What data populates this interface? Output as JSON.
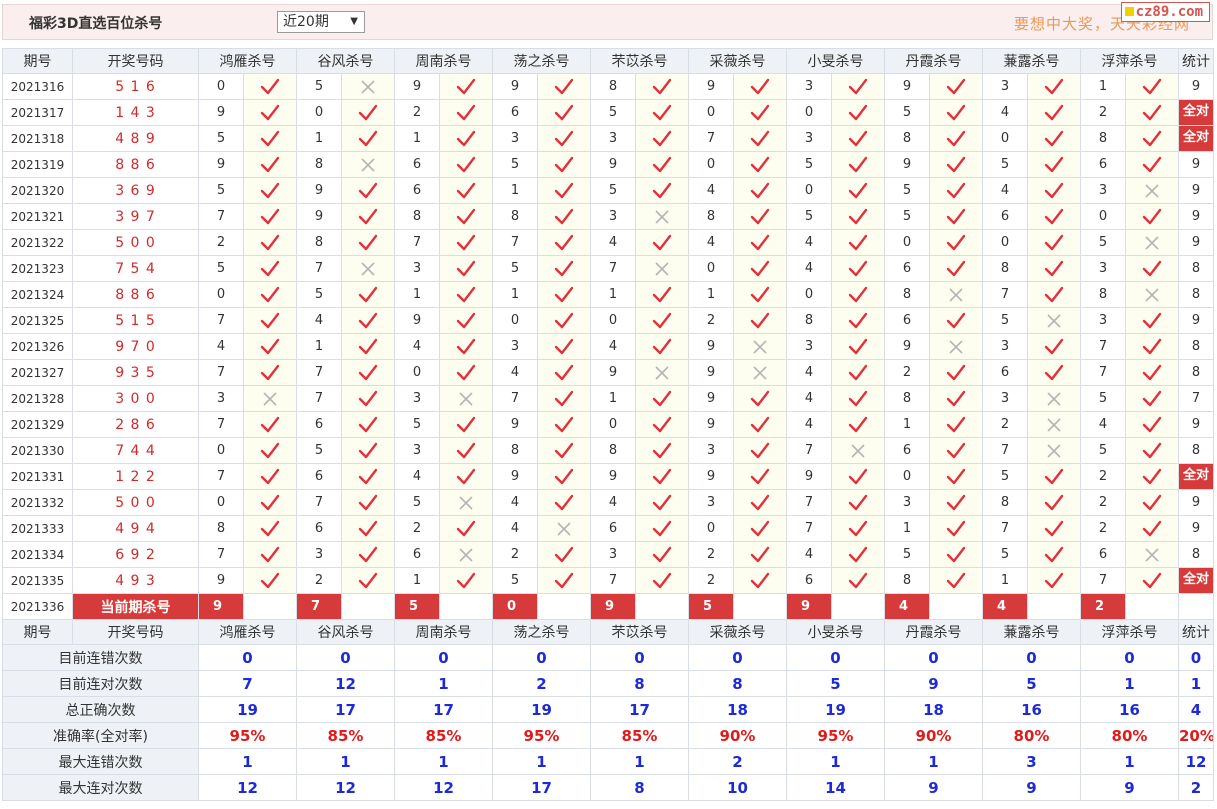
{
  "header": {
    "title": "福彩3D直选百位杀号",
    "period_select": "近20期",
    "slogan": "要想中大奖，天天彩经网",
    "logo": "cz89.com"
  },
  "columns": {
    "period": "期号",
    "draw": "开奖号码",
    "experts": [
      "鸿雁杀号",
      "谷风杀号",
      "周南杀号",
      "荡之杀号",
      "芣苡杀号",
      "采薇杀号",
      "小旻杀号",
      "丹霞杀号",
      "蒹露杀号",
      "浮萍杀号"
    ],
    "stat": "统计"
  },
  "all_right_label": "全对",
  "rows": [
    {
      "period": "2021316",
      "draw": "5 1 6",
      "kills": [
        0,
        5,
        9,
        9,
        8,
        9,
        3,
        9,
        3,
        1
      ],
      "ok": [
        1,
        0,
        1,
        1,
        1,
        1,
        1,
        1,
        1,
        1
      ],
      "stat": "9"
    },
    {
      "period": "2021317",
      "draw": "1 4 3",
      "kills": [
        9,
        0,
        2,
        6,
        5,
        0,
        0,
        5,
        4,
        2
      ],
      "ok": [
        1,
        1,
        1,
        1,
        1,
        1,
        1,
        1,
        1,
        1
      ],
      "stat": "全对"
    },
    {
      "period": "2021318",
      "draw": "4 8 9",
      "kills": [
        5,
        1,
        1,
        3,
        3,
        7,
        3,
        8,
        0,
        8
      ],
      "ok": [
        1,
        1,
        1,
        1,
        1,
        1,
        1,
        1,
        1,
        1
      ],
      "stat": "全对"
    },
    {
      "period": "2021319",
      "draw": "8 8 6",
      "kills": [
        9,
        8,
        6,
        5,
        9,
        0,
        5,
        9,
        5,
        6
      ],
      "ok": [
        1,
        0,
        1,
        1,
        1,
        1,
        1,
        1,
        1,
        1
      ],
      "stat": "9"
    },
    {
      "period": "2021320",
      "draw": "3 6 9",
      "kills": [
        5,
        9,
        6,
        1,
        5,
        4,
        0,
        5,
        4,
        3
      ],
      "ok": [
        1,
        1,
        1,
        1,
        1,
        1,
        1,
        1,
        1,
        0
      ],
      "stat": "9"
    },
    {
      "period": "2021321",
      "draw": "3 9 7",
      "kills": [
        7,
        9,
        8,
        8,
        3,
        8,
        5,
        5,
        6,
        0
      ],
      "ok": [
        1,
        1,
        1,
        1,
        0,
        1,
        1,
        1,
        1,
        1
      ],
      "stat": "9"
    },
    {
      "period": "2021322",
      "draw": "5 0 0",
      "kills": [
        2,
        8,
        7,
        7,
        4,
        4,
        4,
        0,
        0,
        5
      ],
      "ok": [
        1,
        1,
        1,
        1,
        1,
        1,
        1,
        1,
        1,
        0
      ],
      "stat": "9"
    },
    {
      "period": "2021323",
      "draw": "7 5 4",
      "kills": [
        5,
        7,
        3,
        5,
        7,
        0,
        4,
        6,
        8,
        3
      ],
      "ok": [
        1,
        0,
        1,
        1,
        0,
        1,
        1,
        1,
        1,
        1
      ],
      "stat": "8"
    },
    {
      "period": "2021324",
      "draw": "8 8 6",
      "kills": [
        0,
        5,
        1,
        1,
        1,
        1,
        0,
        8,
        7,
        8
      ],
      "ok": [
        1,
        1,
        1,
        1,
        1,
        1,
        1,
        0,
        1,
        0
      ],
      "stat": "8"
    },
    {
      "period": "2021325",
      "draw": "5 1 5",
      "kills": [
        7,
        4,
        9,
        0,
        0,
        2,
        8,
        6,
        5,
        3
      ],
      "ok": [
        1,
        1,
        1,
        1,
        1,
        1,
        1,
        1,
        0,
        1
      ],
      "stat": "9"
    },
    {
      "period": "2021326",
      "draw": "9 7 0",
      "kills": [
        4,
        1,
        4,
        3,
        4,
        9,
        3,
        9,
        3,
        7
      ],
      "ok": [
        1,
        1,
        1,
        1,
        1,
        0,
        1,
        0,
        1,
        1
      ],
      "stat": "8"
    },
    {
      "period": "2021327",
      "draw": "9 3 5",
      "kills": [
        7,
        7,
        0,
        4,
        9,
        9,
        4,
        2,
        6,
        7
      ],
      "ok": [
        1,
        1,
        1,
        1,
        0,
        0,
        1,
        1,
        1,
        1
      ],
      "stat": "8"
    },
    {
      "period": "2021328",
      "draw": "3 0 0",
      "kills": [
        3,
        7,
        3,
        7,
        1,
        9,
        4,
        8,
        3,
        5
      ],
      "ok": [
        0,
        1,
        0,
        1,
        1,
        1,
        1,
        1,
        0,
        1
      ],
      "stat": "7"
    },
    {
      "period": "2021329",
      "draw": "2 8 6",
      "kills": [
        7,
        6,
        5,
        9,
        0,
        9,
        4,
        1,
        2,
        4
      ],
      "ok": [
        1,
        1,
        1,
        1,
        1,
        1,
        1,
        1,
        0,
        1
      ],
      "stat": "9"
    },
    {
      "period": "2021330",
      "draw": "7 4 4",
      "kills": [
        0,
        5,
        3,
        8,
        8,
        3,
        7,
        6,
        7,
        5
      ],
      "ok": [
        1,
        1,
        1,
        1,
        1,
        1,
        0,
        1,
        0,
        1
      ],
      "stat": "8"
    },
    {
      "period": "2021331",
      "draw": "1 2 2",
      "kills": [
        7,
        6,
        4,
        9,
        9,
        9,
        9,
        0,
        5,
        2
      ],
      "ok": [
        1,
        1,
        1,
        1,
        1,
        1,
        1,
        1,
        1,
        1
      ],
      "stat": "全对"
    },
    {
      "period": "2021332",
      "draw": "5 0 0",
      "kills": [
        0,
        7,
        5,
        4,
        4,
        3,
        7,
        3,
        8,
        2
      ],
      "ok": [
        1,
        1,
        0,
        1,
        1,
        1,
        1,
        1,
        1,
        1
      ],
      "stat": "9"
    },
    {
      "period": "2021333",
      "draw": "4 9 4",
      "kills": [
        8,
        6,
        2,
        4,
        6,
        0,
        7,
        1,
        7,
        2
      ],
      "ok": [
        1,
        1,
        1,
        0,
        1,
        1,
        1,
        1,
        1,
        1
      ],
      "stat": "9"
    },
    {
      "period": "2021334",
      "draw": "6 9 2",
      "kills": [
        7,
        3,
        6,
        2,
        3,
        2,
        4,
        5,
        5,
        6
      ],
      "ok": [
        1,
        1,
        0,
        1,
        1,
        1,
        1,
        1,
        1,
        0
      ],
      "stat": "8"
    },
    {
      "period": "2021335",
      "draw": "4 9 3",
      "kills": [
        9,
        2,
        1,
        5,
        7,
        2,
        6,
        8,
        1,
        7
      ],
      "ok": [
        1,
        1,
        1,
        1,
        1,
        1,
        1,
        1,
        1,
        1
      ],
      "stat": "全对"
    }
  ],
  "current": {
    "period": "2021336",
    "label": "当前期杀号",
    "kills": [
      9,
      7,
      5,
      0,
      9,
      5,
      9,
      4,
      4,
      2
    ]
  },
  "stats": [
    {
      "label": "目前连错次数",
      "values": [
        "0",
        "0",
        "0",
        "0",
        "0",
        "0",
        "0",
        "0",
        "0",
        "0",
        "0"
      ]
    },
    {
      "label": "目前连对次数",
      "values": [
        "7",
        "12",
        "1",
        "2",
        "8",
        "8",
        "5",
        "9",
        "5",
        "1",
        "1"
      ]
    },
    {
      "label": "总正确次数",
      "values": [
        "19",
        "17",
        "17",
        "19",
        "17",
        "18",
        "19",
        "18",
        "16",
        "16",
        "4"
      ]
    },
    {
      "label": "准确率(全对率)",
      "values": [
        "95%",
        "85%",
        "85%",
        "95%",
        "85%",
        "90%",
        "95%",
        "90%",
        "80%",
        "80%",
        "20%"
      ]
    },
    {
      "label": "最大连错次数",
      "values": [
        "1",
        "1",
        "1",
        "1",
        "1",
        "2",
        "1",
        "1",
        "3",
        "1",
        "12"
      ]
    },
    {
      "label": "最大连对次数",
      "values": [
        "12",
        "12",
        "12",
        "17",
        "8",
        "10",
        "14",
        "9",
        "9",
        "9",
        "2"
      ]
    }
  ],
  "colors": {
    "check": "#e0323c",
    "cross": "#b5b5b5",
    "accent": "#d63a3a",
    "stat_blue": "#1d2bd6"
  }
}
